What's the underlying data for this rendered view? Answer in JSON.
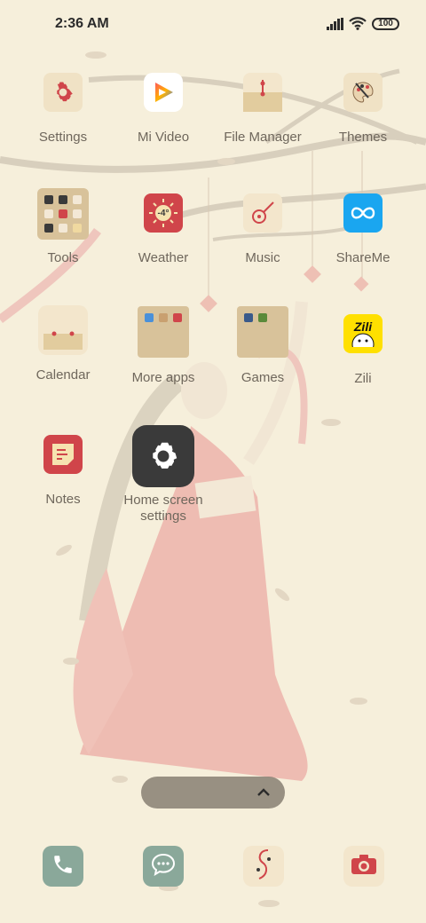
{
  "status": {
    "time": "2:36 AM",
    "battery": "100"
  },
  "apps": [
    {
      "name": "Settings",
      "icon": "settings-gear-icon"
    },
    {
      "name": "Mi Video",
      "icon": "play-icon"
    },
    {
      "name": "File Manager",
      "icon": "folder-icon"
    },
    {
      "name": "Themes",
      "icon": "palette-icon"
    },
    {
      "name": "Tools",
      "icon": "tools-folder-icon"
    },
    {
      "name": "Weather",
      "icon": "sun-icon",
      "temp": "-4°"
    },
    {
      "name": "Music",
      "icon": "lute-icon"
    },
    {
      "name": "ShareMe",
      "icon": "infinity-icon"
    },
    {
      "name": "Calendar",
      "icon": "calendar-icon"
    },
    {
      "name": "More apps",
      "icon": "apps-folder-icon"
    },
    {
      "name": "Games",
      "icon": "games-folder-icon"
    },
    {
      "name": "Zili",
      "icon": "zili-icon",
      "badge": "Zili"
    },
    {
      "name": "Notes",
      "icon": "notes-icon"
    },
    {
      "name": "Home screen settings",
      "icon": "gear-icon"
    }
  ],
  "dock": [
    {
      "name": "Phone",
      "icon": "phone-icon"
    },
    {
      "name": "Messages",
      "icon": "message-icon"
    },
    {
      "name": "Browser",
      "icon": "browser-icon"
    },
    {
      "name": "Camera",
      "icon": "camera-icon"
    }
  ],
  "colors": {
    "background": "#f6efdb",
    "accent_red": "#d0454a",
    "dock_green": "#8aa89a",
    "share_blue": "#1aa6f0",
    "zili_yellow": "#ffe000"
  }
}
